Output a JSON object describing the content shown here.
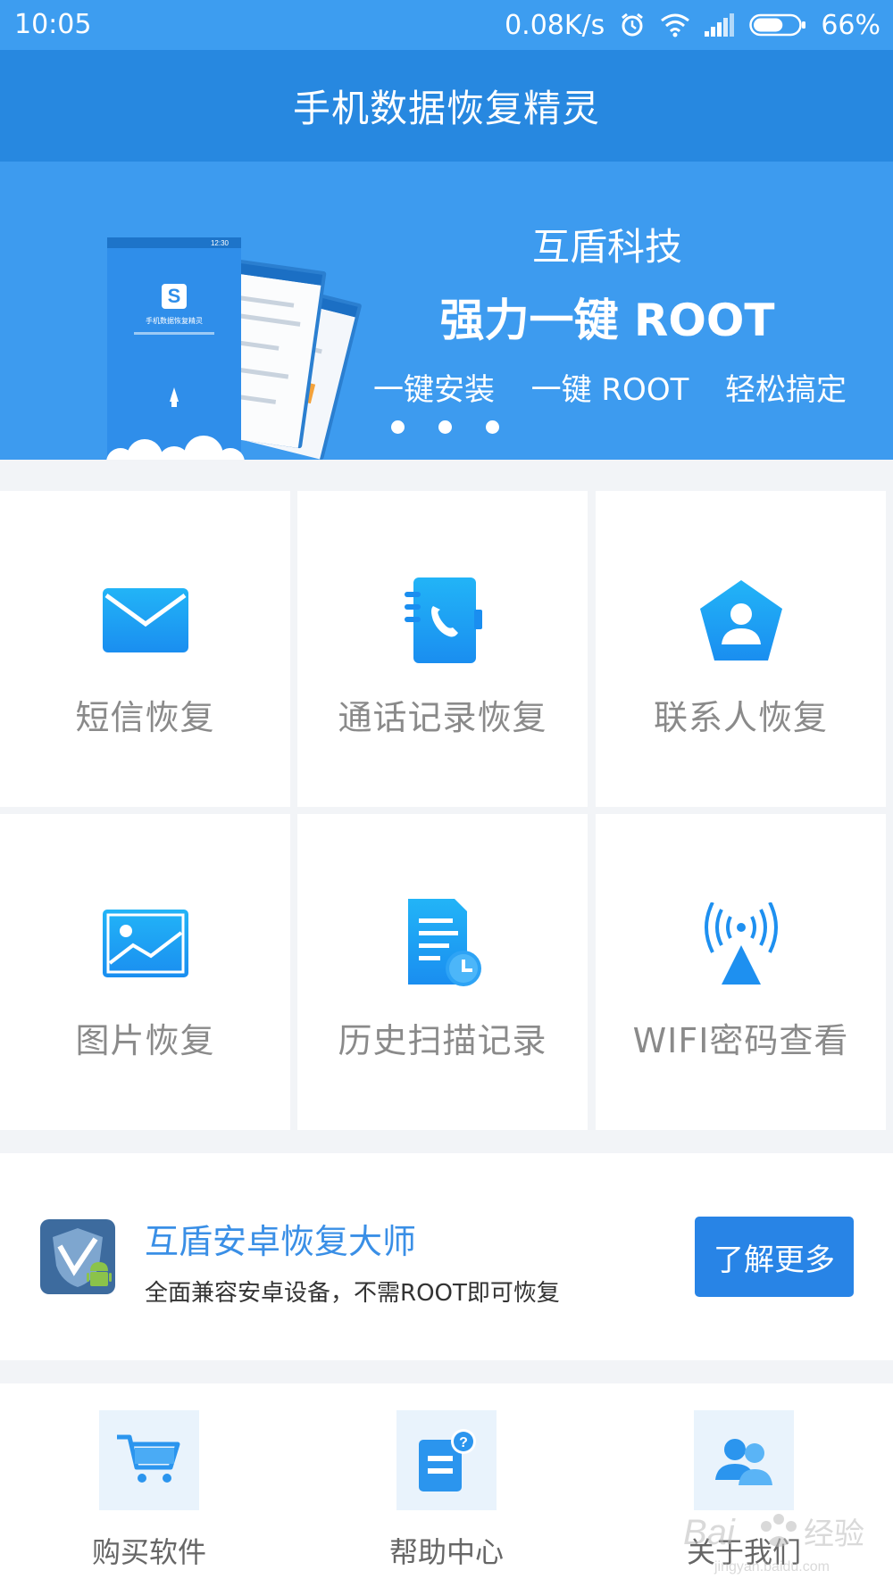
{
  "status_bar": {
    "time": "10:05",
    "network_speed": "0.08K/s",
    "battery": "66%",
    "battery_level": 0.66,
    "icons": [
      "alarm-icon",
      "wifi-icon",
      "signal-icon",
      "battery-icon"
    ]
  },
  "app": {
    "title": "手机数据恢复精灵"
  },
  "banner": {
    "brand": "互盾科技",
    "headline": "强力一键 ROOT",
    "features": [
      "一键安装",
      "一键 ROOT",
      "轻松搞定"
    ],
    "slide_count": 3,
    "mockup_app_name": "手机数据恢复精灵",
    "mockup_time": "12:30"
  },
  "tiles": [
    {
      "label": "短信恢复",
      "icon": "envelope-icon"
    },
    {
      "label": "通话记录恢复",
      "icon": "phone-book-icon"
    },
    {
      "label": "联系人恢复",
      "icon": "contact-person-icon"
    },
    {
      "label": "图片恢复",
      "icon": "picture-icon"
    },
    {
      "label": "历史扫描记录",
      "icon": "history-document-icon"
    },
    {
      "label": "WIFI密码查看",
      "icon": "wifi-tower-icon"
    }
  ],
  "promo": {
    "title": "互盾安卓恢复大师",
    "description": "全面兼容安卓设备，不需ROOT即可恢复",
    "button": "了解更多",
    "icon": "shield-android-icon"
  },
  "bottom_nav": [
    {
      "label": "购买软件",
      "icon": "cart-icon"
    },
    {
      "label": "帮助中心",
      "icon": "help-document-icon"
    },
    {
      "label": "关于我们",
      "icon": "people-icon"
    }
  ],
  "watermark": {
    "text": "Bai经验",
    "sub": "jingyan.baidu.com"
  },
  "colors": {
    "primary": "#2788e0",
    "banner": "#3d9bef",
    "accent_button": "#2884e6",
    "icon_blue": "#1e90f0",
    "tile_label": "#8a8a8a",
    "page_bg": "#f2f4f7"
  }
}
